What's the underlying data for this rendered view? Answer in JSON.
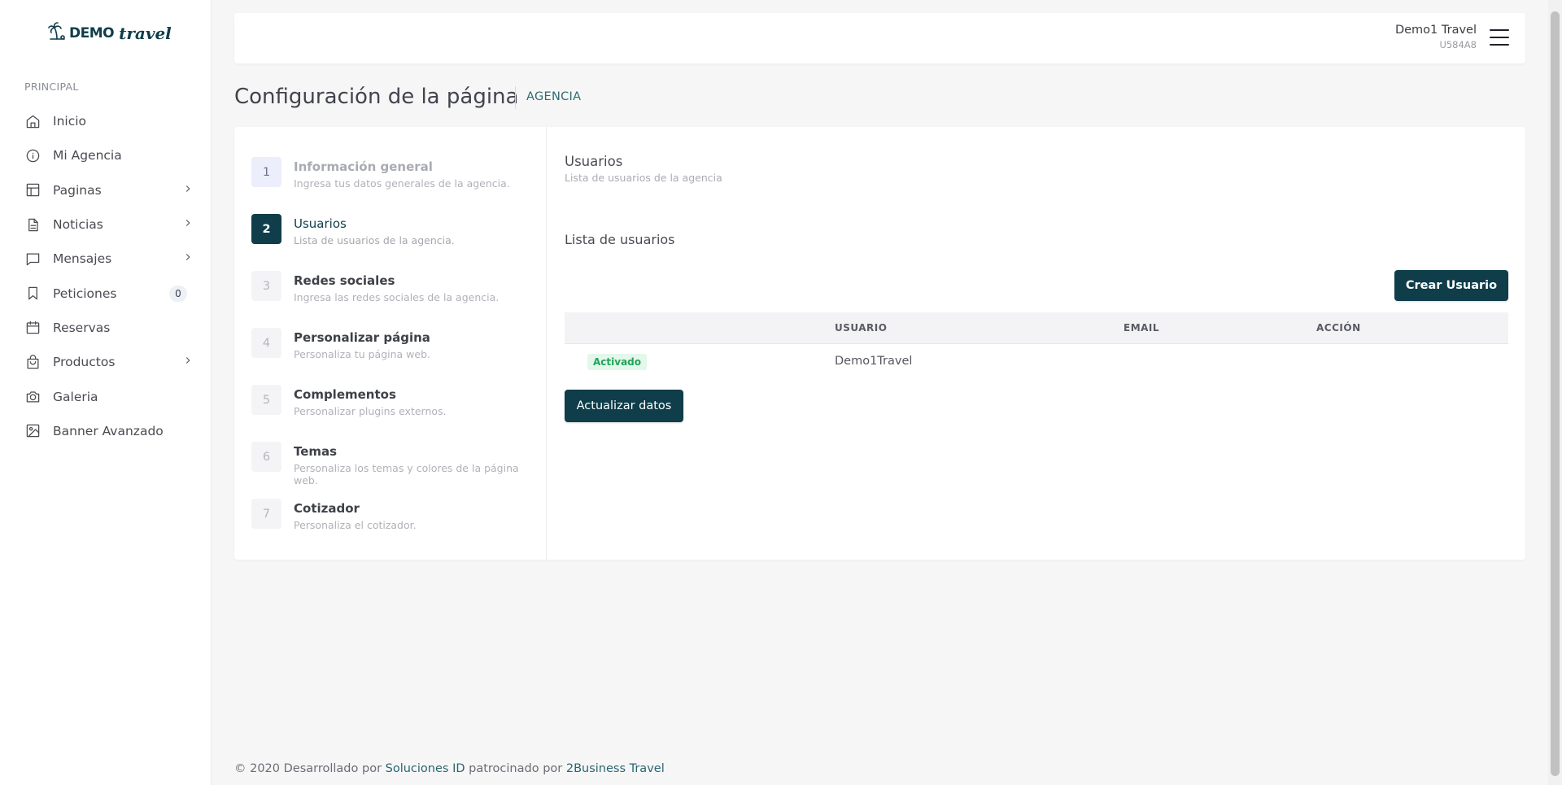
{
  "brand": {
    "word": "DEMO",
    "script": "travel",
    "icon": "palm-tree-icon"
  },
  "sidebar": {
    "section_label": "PRINCIPAL",
    "items": [
      {
        "label": "Inicio",
        "icon": "home-icon",
        "has_chevron": false
      },
      {
        "label": "Mi Agencia",
        "icon": "info-icon",
        "has_chevron": false
      },
      {
        "label": "Paginas",
        "icon": "layout-icon",
        "has_chevron": true
      },
      {
        "label": "Noticias",
        "icon": "document-icon",
        "has_chevron": true
      },
      {
        "label": "Mensajes",
        "icon": "message-icon",
        "has_chevron": true
      },
      {
        "label": "Peticiones",
        "icon": "bookmark-icon",
        "has_chevron": false,
        "badge": "0"
      },
      {
        "label": "Reservas",
        "icon": "calendar-icon",
        "has_chevron": false
      },
      {
        "label": "Productos",
        "icon": "shopping-bag-icon",
        "has_chevron": true
      },
      {
        "label": "Galeria",
        "icon": "camera-icon",
        "has_chevron": false
      },
      {
        "label": "Banner Avanzado",
        "icon": "image-icon",
        "has_chevron": false
      }
    ]
  },
  "header": {
    "user_name": "Demo1 Travel",
    "user_code": "U584A8"
  },
  "page": {
    "title": "Configuración de la página",
    "subtitle": "AGENCIA"
  },
  "steps": [
    {
      "num": "1",
      "title": "Información general",
      "desc": "Ingresa tus datos generales de la agencia."
    },
    {
      "num": "2",
      "title": "Usuarios",
      "desc": "Lista de usuarios de la agencia."
    },
    {
      "num": "3",
      "title": "Redes sociales",
      "desc": "Ingresa las redes sociales de la agencia."
    },
    {
      "num": "4",
      "title": "Personalizar página",
      "desc": "Personaliza tu página web."
    },
    {
      "num": "5",
      "title": "Complementos",
      "desc": "Personalizar plugins externos."
    },
    {
      "num": "6",
      "title": "Temas",
      "desc": "Personaliza los temas y colores de la página web."
    },
    {
      "num": "7",
      "title": "Cotizador",
      "desc": "Personaliza el cotizador."
    }
  ],
  "content": {
    "title": "Usuarios",
    "desc": "Lista de usuarios de la agencia",
    "list_title": "Lista de usuarios",
    "create_button": "Crear Usuario",
    "update_button": "Actualizar datos",
    "table": {
      "headers": [
        "",
        "USUARIO",
        "EMAIL",
        "ACCIÓN"
      ],
      "rows": [
        {
          "status": "Activado",
          "usuario": "Demo1Travel",
          "email": "",
          "accion": ""
        }
      ]
    }
  },
  "footer": {
    "prefix": "© 2020 Desarrollado por",
    "link1": "Soluciones ID",
    "middle": "patrocinado por",
    "link2": "2Business Travel"
  },
  "colors": {
    "primary": "#0f3d4a",
    "status_green": "#22a35a",
    "status_bg": "#e3f7ea",
    "background": "#f6f6f7"
  }
}
